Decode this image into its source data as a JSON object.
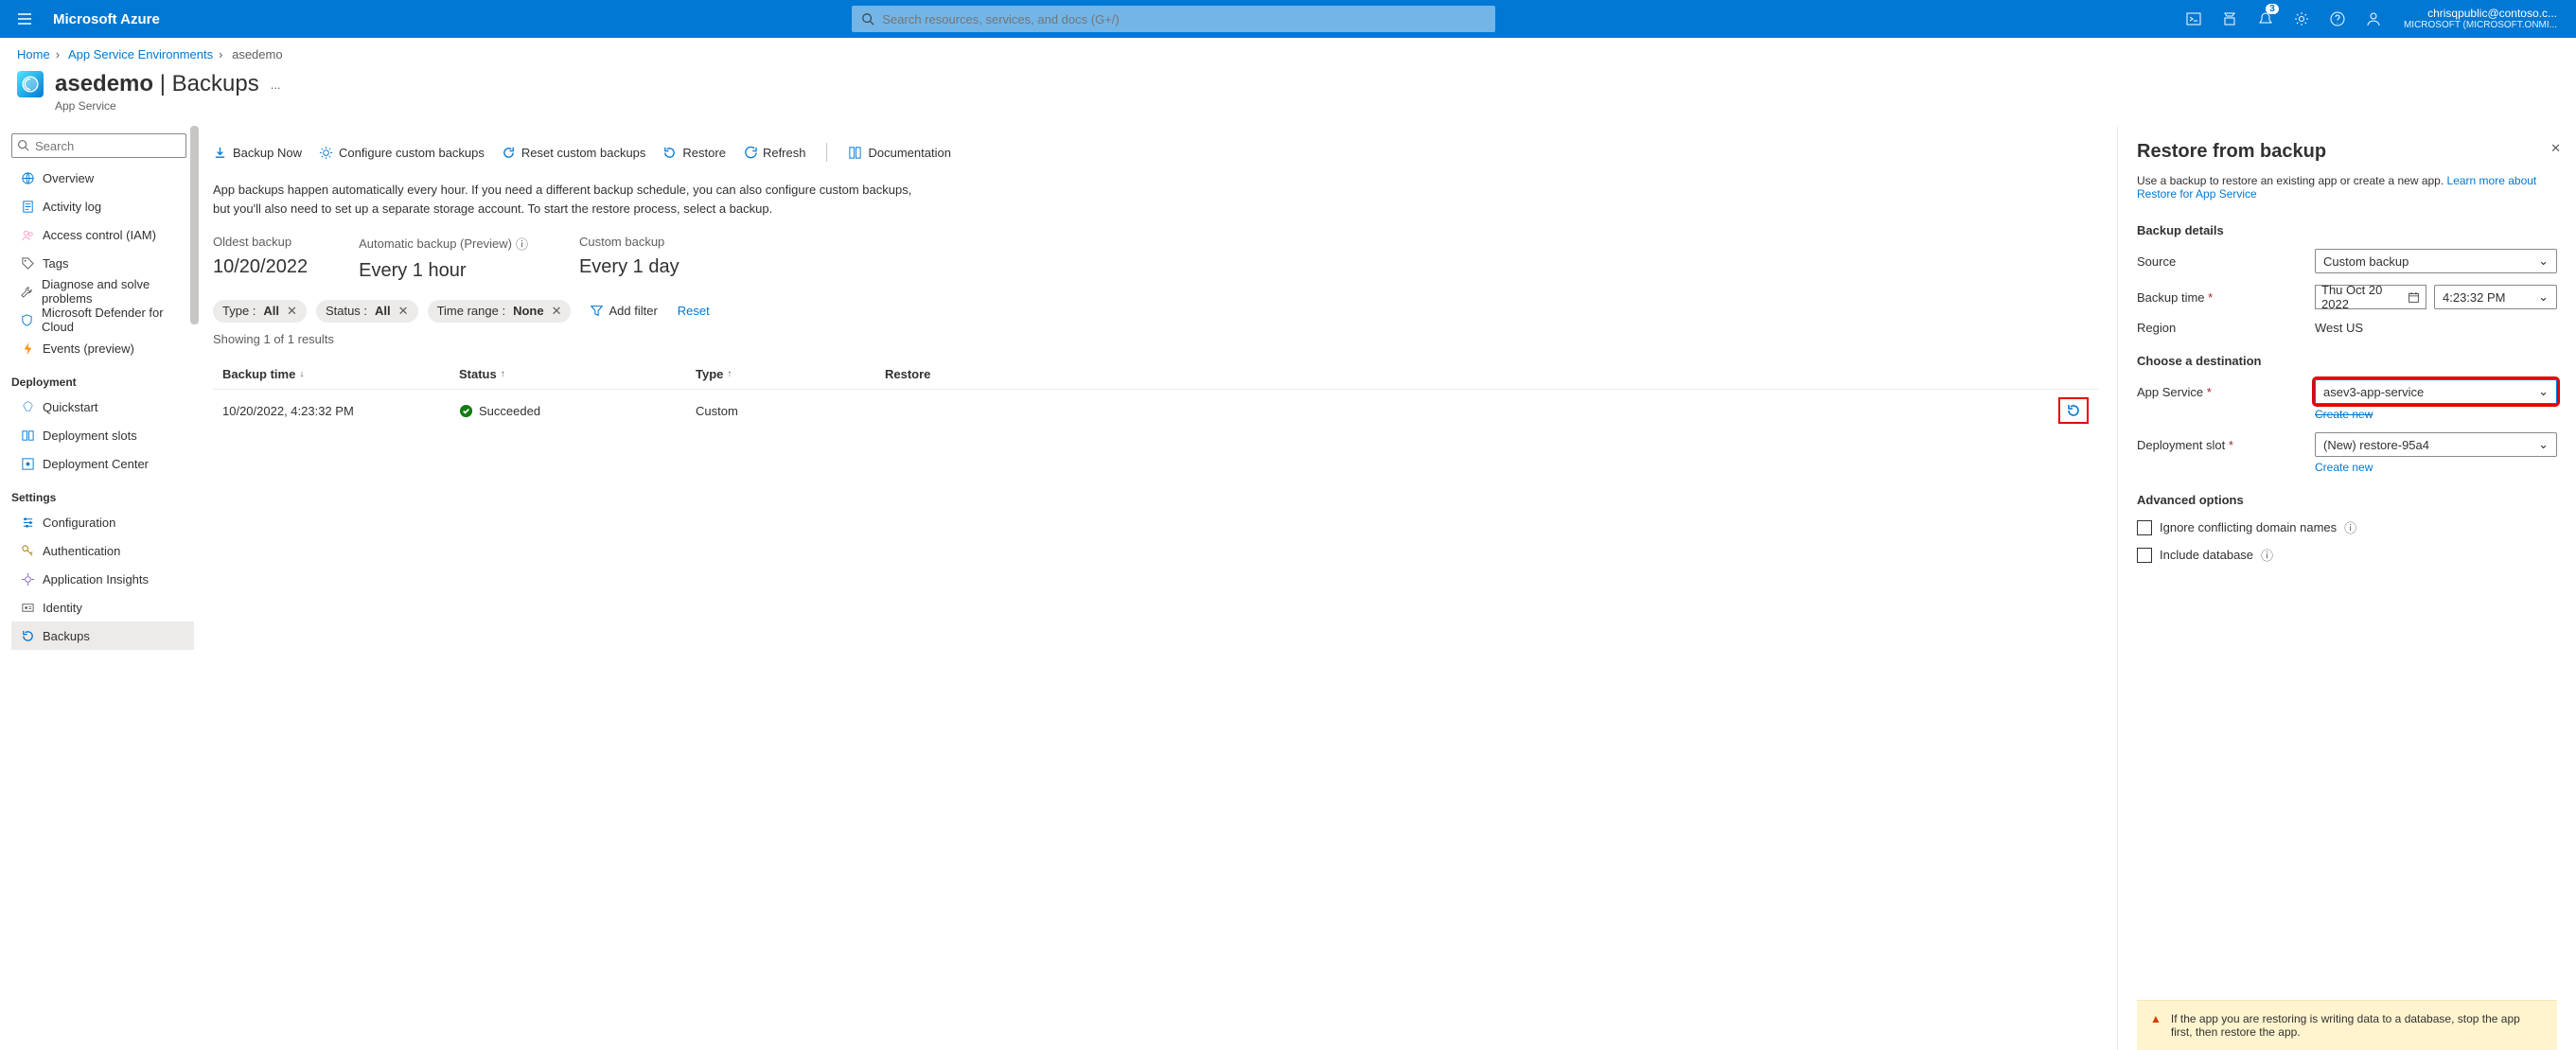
{
  "topbar": {
    "brand": "Microsoft Azure",
    "search_placeholder": "Search resources, services, and docs (G+/)",
    "notification_count": "3",
    "account_email": "chrisqpublic@contoso.c...",
    "account_tenant": "MICROSOFT (MICROSOFT.ONMI..."
  },
  "breadcrumbs": {
    "items": [
      "Home",
      "App Service Environments",
      "asedemo"
    ]
  },
  "page": {
    "title": "asedemo",
    "subtitle": "Backups",
    "resource_type": "App Service",
    "search_placeholder": "Search",
    "more_label": "..."
  },
  "sidebar": {
    "items_top": [
      {
        "label": "Overview",
        "icon": "globe"
      },
      {
        "label": "Activity log",
        "icon": "log"
      },
      {
        "label": "Access control (IAM)",
        "icon": "people"
      },
      {
        "label": "Tags",
        "icon": "tag"
      },
      {
        "label": "Diagnose and solve problems",
        "icon": "wrench"
      },
      {
        "label": "Microsoft Defender for Cloud",
        "icon": "shield"
      },
      {
        "label": "Events (preview)",
        "icon": "bolt"
      }
    ],
    "section_deploy": "Deployment",
    "items_deploy": [
      {
        "label": "Quickstart",
        "icon": "rocket"
      },
      {
        "label": "Deployment slots",
        "icon": "slots"
      },
      {
        "label": "Deployment Center",
        "icon": "center"
      }
    ],
    "section_settings": "Settings",
    "items_settings": [
      {
        "label": "Configuration",
        "icon": "sliders"
      },
      {
        "label": "Authentication",
        "icon": "key"
      },
      {
        "label": "Application Insights",
        "icon": "insights"
      },
      {
        "label": "Identity",
        "icon": "id"
      },
      {
        "label": "Backups",
        "icon": "backup",
        "active": true
      }
    ]
  },
  "toolbar": {
    "backup_now": "Backup Now",
    "configure": "Configure custom backups",
    "reset": "Reset custom backups",
    "restore": "Restore",
    "refresh": "Refresh",
    "docs": "Documentation"
  },
  "description": "App backups happen automatically every hour. If you need a different backup schedule, you can also configure custom backups, but you'll also need to set up a separate storage account. To start the restore process, select a backup.",
  "summary": {
    "oldest_label": "Oldest backup",
    "oldest_value": "10/20/2022",
    "auto_label": "Automatic backup (Preview)",
    "auto_value": "Every 1 hour",
    "custom_label": "Custom backup",
    "custom_value": "Every 1 day"
  },
  "filters": {
    "type_key": "Type :",
    "type_val": "All",
    "status_key": "Status :",
    "status_val": "All",
    "time_key": "Time range :",
    "time_val": "None",
    "add_filter": "Add filter",
    "reset": "Reset"
  },
  "results": {
    "count_text": "Showing 1 of 1 results",
    "headers": {
      "time": "Backup time",
      "status": "Status",
      "type": "Type",
      "restore": "Restore"
    },
    "rows": [
      {
        "time": "10/20/2022, 4:23:32 PM",
        "status": "Succeeded",
        "type": "Custom"
      }
    ]
  },
  "blade": {
    "title": "Restore from backup",
    "desc_pre": "Use a backup to restore an existing app or create a new app. ",
    "desc_link": "Learn more about Restore for App Service",
    "section_details": "Backup details",
    "source_label": "Source",
    "source_value": "Custom backup",
    "time_label": "Backup time",
    "date_value": "Thu Oct 20 2022",
    "time_value": "4:23:32 PM",
    "region_label": "Region",
    "region_value": "West US",
    "section_dest": "Choose a destination",
    "app_label": "App Service",
    "app_value": "asev3-app-service",
    "app_create": "Create new",
    "slot_label": "Deployment slot",
    "slot_value": "(New) restore-95a4",
    "slot_create": "Create new",
    "section_adv": "Advanced options",
    "ignore_label": "Ignore conflicting domain names",
    "include_label": "Include database",
    "warning": "If the app you are restoring is writing data to a database, stop the app first, then restore the app."
  }
}
